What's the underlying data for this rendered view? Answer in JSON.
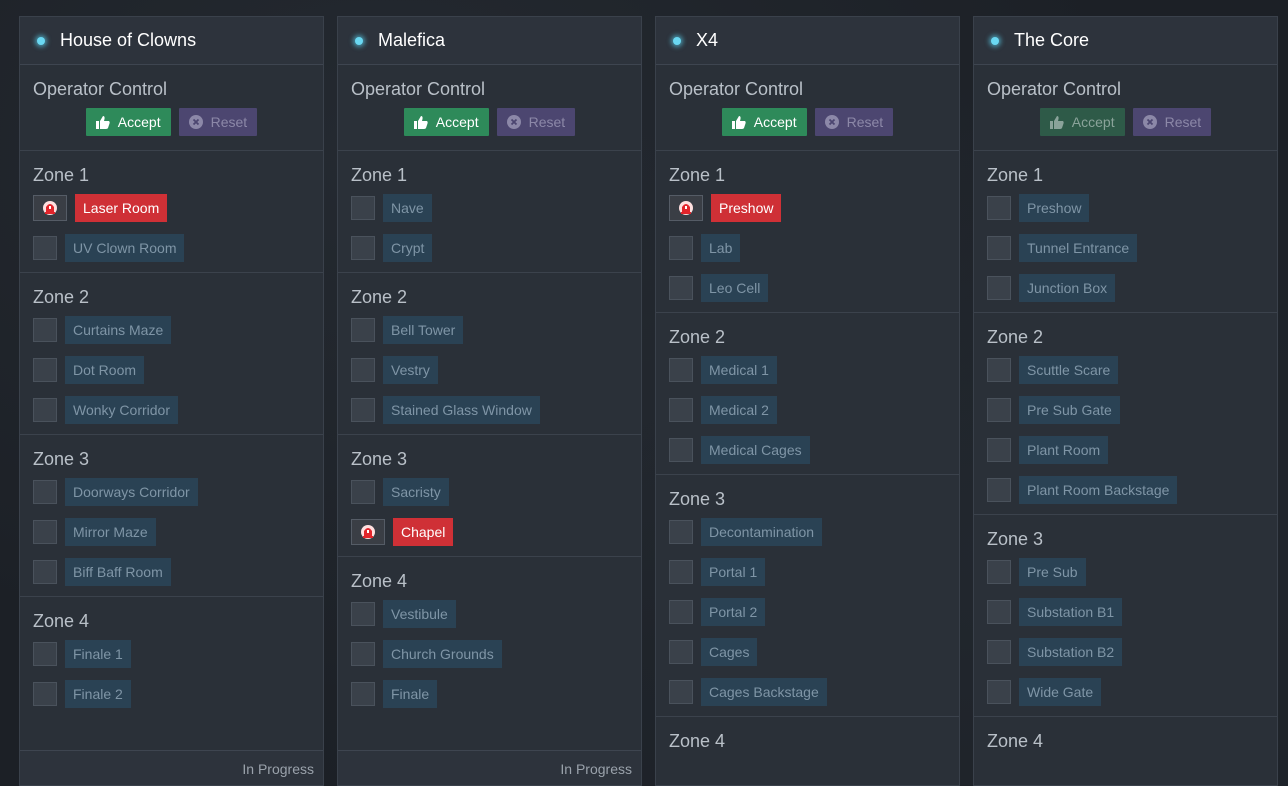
{
  "colors": {
    "accent_led": "#6ad8f2",
    "accept": "#2e8a5a",
    "reset": "#4c4670",
    "room": "#2a4254",
    "alarm": "#cf3036"
  },
  "panels": [
    {
      "title": "House of Clowns",
      "operator": {
        "title": "Operator Control",
        "accept": "Accept",
        "reset": "Reset"
      },
      "zones": [
        {
          "title": "Zone 1",
          "rooms": [
            {
              "name": "Laser Room",
              "alarm": true
            },
            {
              "name": "UV Clown Room",
              "alarm": false
            }
          ]
        },
        {
          "title": "Zone 2",
          "rooms": [
            {
              "name": "Curtains Maze",
              "alarm": false
            },
            {
              "name": "Dot Room",
              "alarm": false
            },
            {
              "name": "Wonky Corridor",
              "alarm": false
            }
          ]
        },
        {
          "title": "Zone 3",
          "rooms": [
            {
              "name": "Doorways Corridor",
              "alarm": false
            },
            {
              "name": "Mirror Maze",
              "alarm": false
            },
            {
              "name": "Biff Baff Room",
              "alarm": false
            }
          ]
        },
        {
          "title": "Zone 4",
          "rooms": [
            {
              "name": "Finale 1",
              "alarm": false
            },
            {
              "name": "Finale 2",
              "alarm": false
            }
          ]
        }
      ],
      "status": "In Progress"
    },
    {
      "title": "Malefica",
      "operator": {
        "title": "Operator Control",
        "accept": "Accept",
        "reset": "Reset"
      },
      "zones": [
        {
          "title": "Zone 1",
          "rooms": [
            {
              "name": "Nave",
              "alarm": false
            },
            {
              "name": "Crypt",
              "alarm": false
            }
          ]
        },
        {
          "title": "Zone 2",
          "rooms": [
            {
              "name": "Bell Tower",
              "alarm": false
            },
            {
              "name": "Vestry",
              "alarm": false
            },
            {
              "name": "Stained Glass Window",
              "alarm": false
            }
          ]
        },
        {
          "title": "Zone 3",
          "rooms": [
            {
              "name": "Sacristy",
              "alarm": false
            },
            {
              "name": "Chapel",
              "alarm": true
            }
          ]
        },
        {
          "title": "Zone 4",
          "rooms": [
            {
              "name": "Vestibule",
              "alarm": false
            },
            {
              "name": "Church Grounds",
              "alarm": false
            },
            {
              "name": "Finale",
              "alarm": false
            }
          ]
        }
      ],
      "status": "In Progress"
    },
    {
      "title": "X4",
      "operator": {
        "title": "Operator Control",
        "accept": "Accept",
        "reset": "Reset"
      },
      "zones": [
        {
          "title": "Zone 1",
          "rooms": [
            {
              "name": "Preshow",
              "alarm": true
            },
            {
              "name": "Lab",
              "alarm": false
            },
            {
              "name": "Leo Cell",
              "alarm": false
            }
          ]
        },
        {
          "title": "Zone 2",
          "rooms": [
            {
              "name": "Medical 1",
              "alarm": false
            },
            {
              "name": "Medical 2",
              "alarm": false
            },
            {
              "name": "Medical Cages",
              "alarm": false
            }
          ]
        },
        {
          "title": "Zone 3",
          "rooms": [
            {
              "name": "Decontamination",
              "alarm": false
            },
            {
              "name": "Portal 1",
              "alarm": false
            },
            {
              "name": "Portal 2",
              "alarm": false
            },
            {
              "name": "Cages",
              "alarm": false
            },
            {
              "name": "Cages Backstage",
              "alarm": false
            }
          ]
        },
        {
          "title": "Zone 4",
          "rooms": []
        }
      ]
    },
    {
      "title": "The Core",
      "operator": {
        "title": "Operator Control",
        "accept": "Accept",
        "reset": "Reset"
      },
      "zones": [
        {
          "title": "Zone 1",
          "rooms": [
            {
              "name": "Preshow",
              "alarm": false
            },
            {
              "name": "Tunnel Entrance",
              "alarm": false
            },
            {
              "name": "Junction Box",
              "alarm": false
            }
          ]
        },
        {
          "title": "Zone 2",
          "rooms": [
            {
              "name": "Scuttle Scare",
              "alarm": false
            },
            {
              "name": "Pre Sub Gate",
              "alarm": false
            },
            {
              "name": "Plant Room",
              "alarm": false
            },
            {
              "name": "Plant Room Backstage",
              "alarm": false
            }
          ]
        },
        {
          "title": "Zone 3",
          "rooms": [
            {
              "name": "Pre Sub",
              "alarm": false
            },
            {
              "name": "Substation B1",
              "alarm": false
            },
            {
              "name": "Substation B2",
              "alarm": false
            },
            {
              "name": "Wide Gate",
              "alarm": false
            }
          ]
        },
        {
          "title": "Zone 4",
          "rooms": []
        }
      ]
    }
  ]
}
